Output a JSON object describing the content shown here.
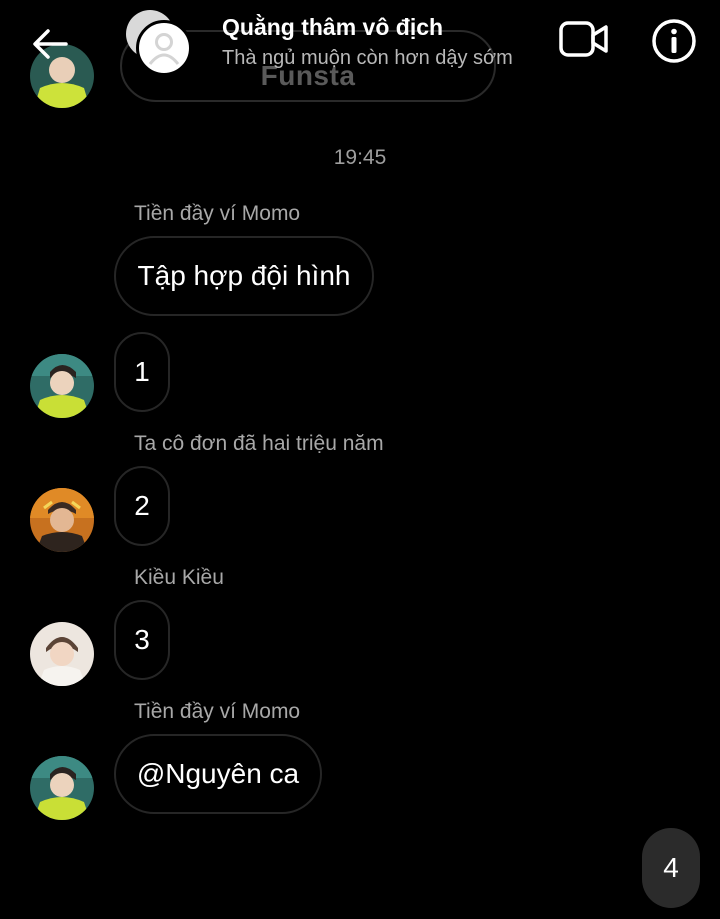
{
  "header": {
    "title": "Quằng thâm vô địch",
    "subtitle": "Thà ngủ muộn còn hơn dậy sớm",
    "back_icon": "back-arrow-icon",
    "video_icon": "video-call-icon",
    "info_icon": "info-icon"
  },
  "previous_message": {
    "text": "Funsta"
  },
  "timestamp": "19:45",
  "messages": [
    {
      "sender": "Tiền đầy ví Momo",
      "text": "Tập hợp đội hình"
    },
    {
      "sender": "",
      "text": "1"
    },
    {
      "sender": "Ta cô đơn đã hai triệu năm",
      "text": "2"
    },
    {
      "sender": "Kiều Kiều",
      "text": "3"
    },
    {
      "sender": "Tiền đầy ví Momo",
      "text": "@Nguyên ca"
    }
  ],
  "composer_bubble": {
    "text": "4"
  },
  "colors": {
    "background": "#000000",
    "bubble_border": "#262626",
    "secondary_text": "#a8a8a8",
    "own_bubble": "#2b2b2b"
  }
}
